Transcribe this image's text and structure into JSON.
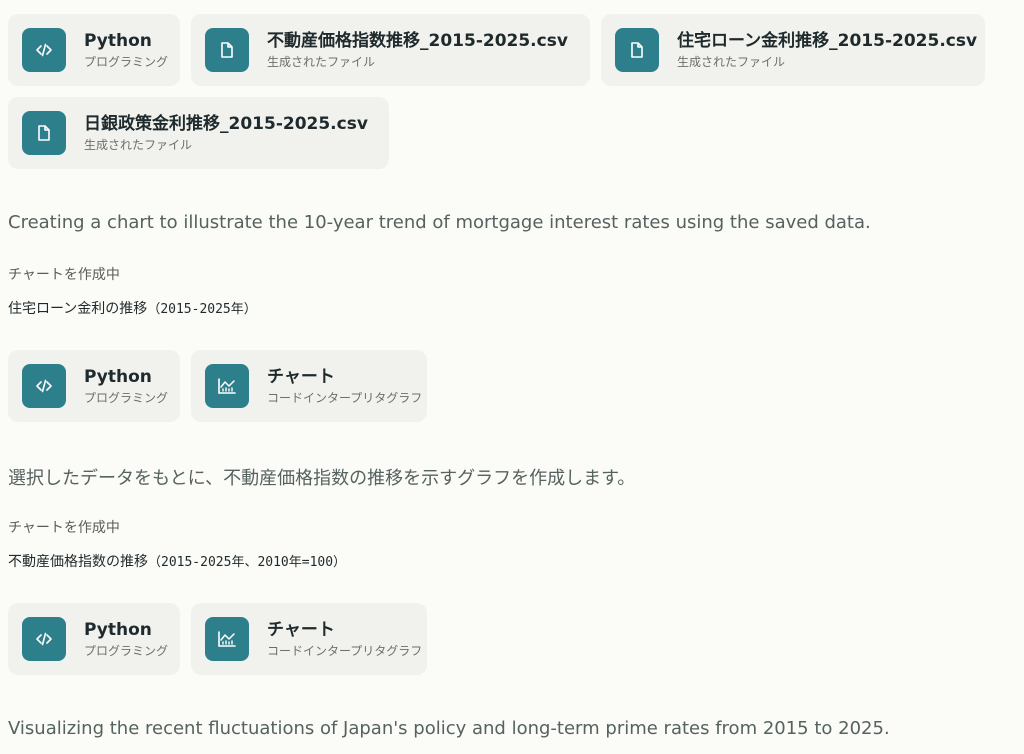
{
  "files_row": [
    {
      "title": "Python",
      "subtitle": "プログラミング",
      "icon": "code-icon"
    },
    {
      "title": "不動産価格指数推移_2015-2025.csv",
      "subtitle": "生成されたファイル",
      "icon": "file-icon"
    },
    {
      "title": "住宅ローン金利推移_2015-2025.csv",
      "subtitle": "生成されたファイル",
      "icon": "file-icon"
    },
    {
      "title": "日銀政策金利推移_2015-2025.csv",
      "subtitle": "生成されたファイル",
      "icon": "file-icon"
    }
  ],
  "message1": "Creating a chart to illustrate the 10-year trend of mortgage interest rates using the saved data.",
  "step1": {
    "status": "チャートを作成中",
    "chart_title": "住宅ローン金利の推移",
    "chart_title_paren": "（2015-2025年）",
    "cards": [
      {
        "title": "Python",
        "subtitle": "プログラミング",
        "icon": "code-icon"
      },
      {
        "title": "チャート",
        "subtitle": "コードインタープリタグラフ",
        "icon": "chart-icon"
      }
    ]
  },
  "message2": "選択したデータをもとに、不動産価格指数の推移を示すグラフを作成します。",
  "step2": {
    "status": "チャートを作成中",
    "chart_title": "不動産価格指数の推移",
    "chart_title_paren": "（2015-2025年、2010年=100）",
    "cards": [
      {
        "title": "Python",
        "subtitle": "プログラミング",
        "icon": "code-icon"
      },
      {
        "title": "チャート",
        "subtitle": "コードインタープリタグラフ",
        "icon": "chart-icon"
      }
    ]
  },
  "message3": "Visualizing the recent fluctuations of Japan's policy and long-term prime rates from 2015 to 2025.",
  "colors": {
    "icon_bg": "#2e7f8c",
    "card_bg": "#f1f1ee",
    "page_bg": "#fbfbf7"
  }
}
